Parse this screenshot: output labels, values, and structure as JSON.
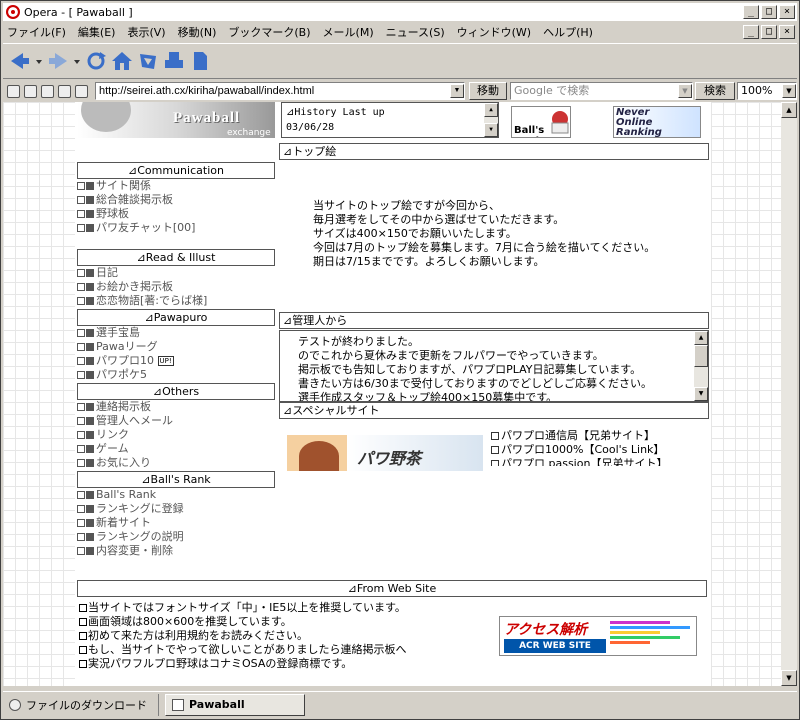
{
  "window": {
    "title": "Opera - [ Pawaball ]",
    "controls": [
      "_",
      "□",
      "×"
    ],
    "doc_controls": [
      "_",
      "□",
      "×"
    ]
  },
  "menu": [
    "ファイル(F)",
    "編集(E)",
    "表示(V)",
    "移動(N)",
    "ブックマーク(B)",
    "メール(M)",
    "ニュース(S)",
    "ウィンドウ(W)",
    "ヘルプ(H)"
  ],
  "toolbar": {
    "icons": [
      "back-icon",
      "forward-icon",
      "reload-icon",
      "home-icon",
      "hotlist-icon",
      "print-icon",
      "note-icon"
    ]
  },
  "address": {
    "url": "http://seirei.ath.cx/kiriha/pawaball/index.html",
    "go_label": "移動",
    "search_placeholder": "Google で検索",
    "search_button": "検索",
    "zoom": "100%"
  },
  "page": {
    "banner_title": "Pawaball",
    "banner_sub": "exchange",
    "history_lines": [
      "⊿History    Last up",
      "03/06/28"
    ],
    "banner_ballsrank": "Ball's Rank",
    "banner_never": [
      "Never",
      "Online",
      "Ranking"
    ],
    "nav": [
      {
        "header": "⊿Communication",
        "items": [
          "サイト関係",
          "総合雑談掲示板",
          "野球板",
          "パワ友チャット[00]"
        ]
      },
      {
        "header": "⊿Read & Illust",
        "items": [
          "日記",
          "お絵かき掲示板",
          "恋恋物語[著:でらば様]"
        ]
      },
      {
        "header": "⊿Pawapuro",
        "items": [
          "選手宝島",
          "Pawaリーグ",
          "パワプロ10",
          "パワポケ5"
        ]
      },
      {
        "header": "⊿Others",
        "items": [
          "連絡掲示板",
          "管理人へメール",
          "リンク",
          "ゲーム",
          "お気に入り"
        ]
      },
      {
        "header": "⊿Ball's Rank",
        "items": [
          "Ball's Rank",
          "ランキングに登録",
          "新着サイト",
          "ランキングの説明",
          "内容変更・削除"
        ]
      }
    ],
    "up_badge": "UP!",
    "top_header": "⊿トップ絵",
    "top_body": [
      "当サイトのトップ絵ですが今回から、",
      "毎月選考をしてその中から選ばせていただきます。",
      "サイズは400×150でお願いいたします。",
      "今回は7月のトップ絵を募集します。7月に合う絵を描いてください。",
      "期日は7/15までです。よろしくお願いします。"
    ],
    "admin_header": "⊿管理人から",
    "admin_body": [
      "テストが終わりました。",
      "のでこれから夏休みまで更新をフルパワーでやっていきます。",
      "掲示板でも告知しておりますが、パワプロPLAY日記募集しています。",
      "書きたい方は6/30まで受付しておりますのでどしどしご応募ください。",
      "選手作成スタッフ＆トップ絵400×150募集中です。"
    ],
    "special_header": "⊿スペシャルサイト",
    "special_banner": "パワ野茶",
    "special_links": [
      "パワプロ通信局【兄弟サイト】",
      "パワプロ1000%【Cool's Link】",
      "パワプロ passion【兄弟サイト】"
    ],
    "web_header": "⊿From Web Site",
    "notes": [
      "当サイトではフォントサイズ「中」・IE5以上を推奨しています。",
      "画面領域は800×600を推奨しています。",
      "初めて来た方は利用規約をお読みください。",
      "もし、当サイトでやって欲しいことがありましたら連絡掲示板へ",
      "実況パワフルプロ野球はコナミOSAの登録商標です。"
    ],
    "acr_title": "アクセス解析",
    "acr_sub": "ACR WEB SITE"
  },
  "status": {
    "tab1": "ファイルのダウンロード",
    "tab2": "Pawaball"
  }
}
